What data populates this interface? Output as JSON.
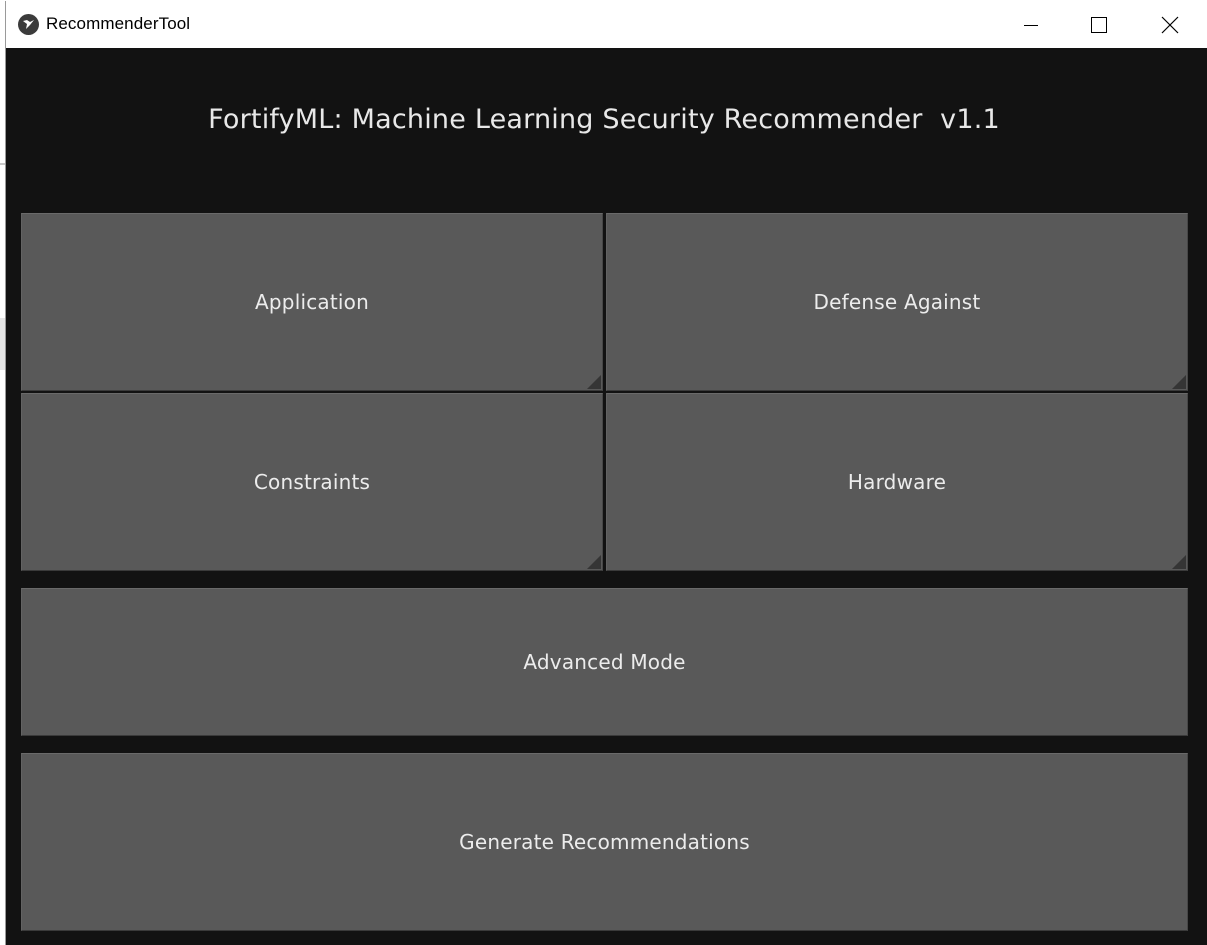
{
  "window": {
    "title": "RecommenderTool",
    "icon": "kivy-app-icon",
    "controls": {
      "minimize_icon": "minimize-icon",
      "maximize_icon": "maximize-icon",
      "close_icon": "close-icon"
    }
  },
  "header": {
    "title": "FortifyML: Machine Learning Security Recommender  v1.1"
  },
  "buttons": {
    "application": "Application",
    "defense_against": "Defense Against",
    "constraints": "Constraints",
    "hardware": "Hardware",
    "advanced_mode": "Advanced Mode",
    "generate_recommendations": "Generate Recommendations"
  },
  "colors": {
    "background": "#121212",
    "button": "#595959",
    "text": "#ececec"
  }
}
